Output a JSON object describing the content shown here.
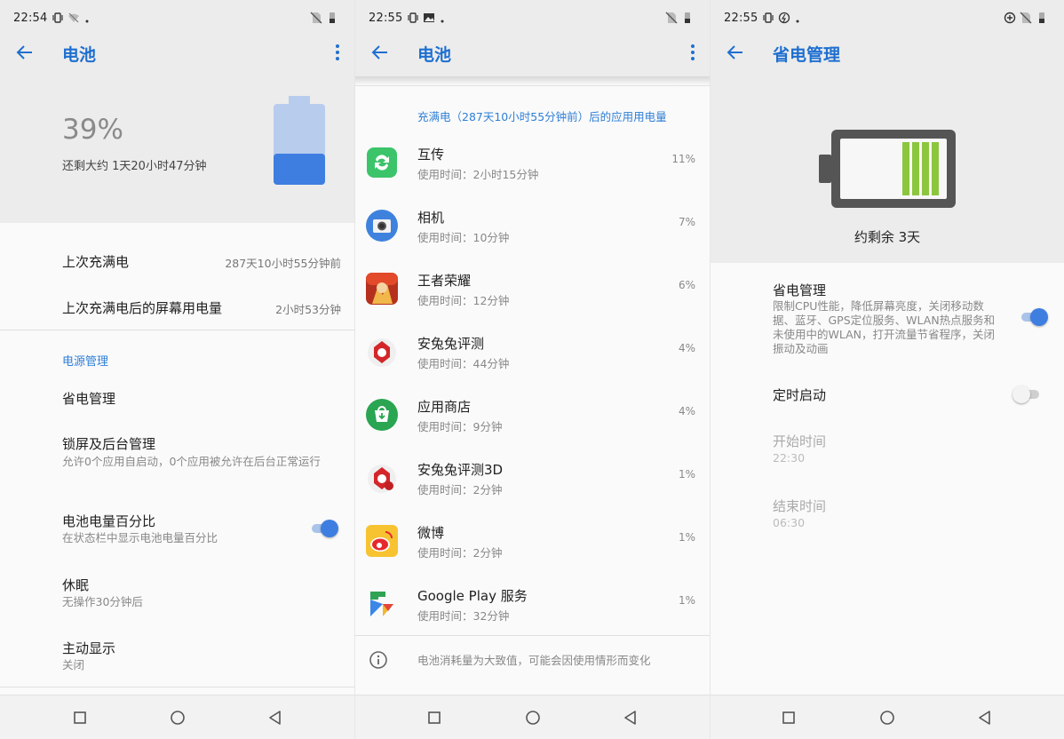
{
  "colors": {
    "accent": "#1e6fd0",
    "section_blue": "#2f7fd6",
    "battery_blue": "#3f7ee1",
    "battery_green": "#8cc63f"
  },
  "screen1": {
    "status": {
      "time": "22:54"
    },
    "title": "电池",
    "battery": {
      "percent": "39%",
      "level": 0.39,
      "remaining": "还剩大约 1天20小时47分钟"
    },
    "last_full_label": "上次充满电",
    "last_full_value": "287天10小时55分钟前",
    "screen_usage_label": "上次充满电后的屏幕用电量",
    "screen_usage_value": "2小时53分钟",
    "section_power": "电源管理",
    "power_saving": "省电管理",
    "lock_bg_title": "锁屏及后台管理",
    "lock_bg_sub": "允许0个应用自启动，0个应用被允许在后台正常运行",
    "battery_pct_title": "电池电量百分比",
    "battery_pct_sub": "在状态栏中显示电池电量百分比",
    "battery_pct_on": true,
    "sleep_title": "休眠",
    "sleep_sub": "无操作30分钟后",
    "ambient_title": "主动显示",
    "ambient_sub": "关闭"
  },
  "screen2": {
    "status": {
      "time": "22:55"
    },
    "title": "电池",
    "usage_header": "充满电（287天10小时55分钟前）后的应用用电量",
    "apps": [
      {
        "name": "互传",
        "time": "使用时间：2小时15分钟",
        "pct": "11%",
        "icon": "transfer-icon"
      },
      {
        "name": "相机",
        "time": "使用时间：10分钟",
        "pct": "7%",
        "icon": "camera-icon"
      },
      {
        "name": "王者荣耀",
        "time": "使用时间：12分钟",
        "pct": "6%",
        "icon": "game-icon"
      },
      {
        "name": "安兔兔评测",
        "time": "使用时间：44分钟",
        "pct": "4%",
        "icon": "antutu-icon"
      },
      {
        "name": "应用商店",
        "time": "使用时间：9分钟",
        "pct": "4%",
        "icon": "store-icon"
      },
      {
        "name": "安兔兔评测3D",
        "time": "使用时间：2分钟",
        "pct": "1%",
        "icon": "antutu3d-icon"
      },
      {
        "name": "微博",
        "time": "使用时间：2分钟",
        "pct": "1%",
        "icon": "weibo-icon"
      },
      {
        "name": "Google Play 服务",
        "time": "使用时间：32分钟",
        "pct": "1%",
        "icon": "play-services-icon"
      }
    ],
    "footer_note": "电池消耗量为大致值，可能会因使用情形而变化"
  },
  "screen3": {
    "status": {
      "time": "22:55"
    },
    "title": "省电管理",
    "remaining": "约剩余 3天",
    "saver_title": "省电管理",
    "saver_sub": "限制CPU性能，降低屏幕亮度，关闭移动数据、蓝牙、GPS定位服务、WLAN热点服务和未使用中的WLAN，打开流量节省程序，关闭振动及动画",
    "saver_on": true,
    "schedule_title": "定时启动",
    "schedule_on": false,
    "start_label": "开始时间",
    "start_value": "22:30",
    "end_label": "结束时间",
    "end_value": "06:30"
  }
}
